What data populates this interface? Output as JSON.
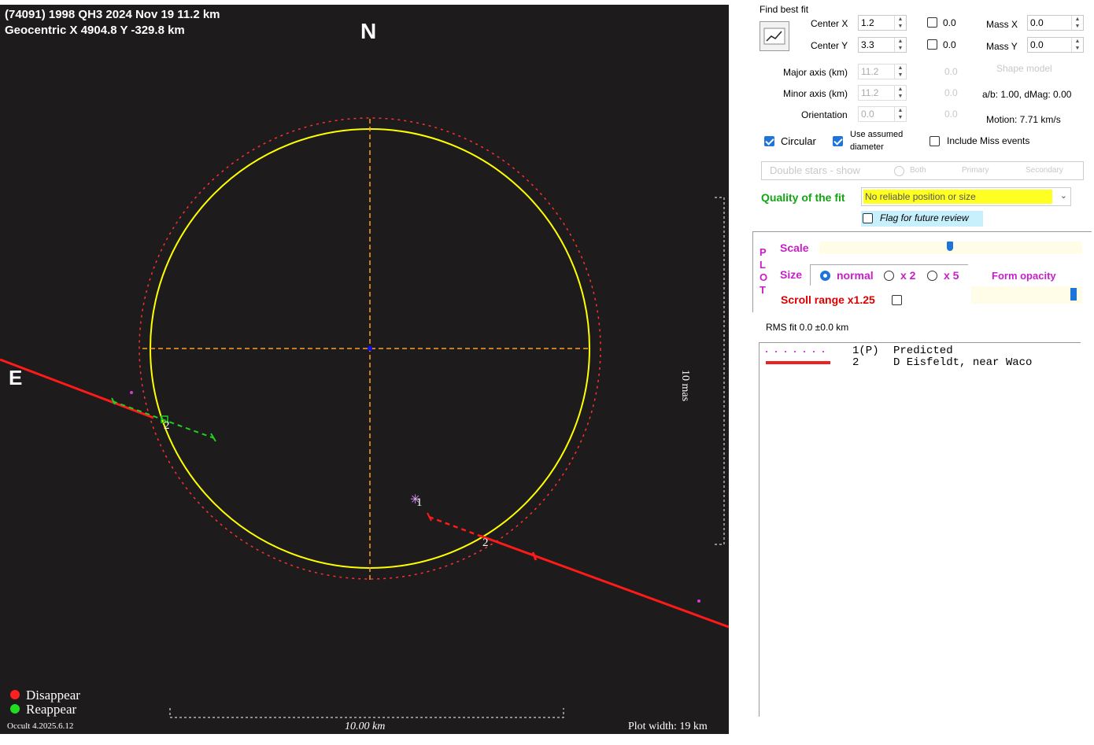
{
  "plot": {
    "title_line1": "(74091) 1998 QH3  2024 Nov 19   11.2 km",
    "title_line2": "Geocentric  X  4904.8  Y -329.8 km",
    "north": "N",
    "east": "E",
    "scale_vertical": "10 mas",
    "scale_horizontal": "10.00 km",
    "plot_width": "Plot width: 19 km",
    "version": "Occult 4.2025.6.12",
    "legend": [
      {
        "label": "Disappear",
        "color": "#ff2020"
      },
      {
        "label": "Reappear",
        "color": "#20dd20"
      }
    ],
    "chord_labels": {
      "predicted": "1",
      "observer": "2"
    },
    "colors": {
      "ellipse": "#ffff00",
      "dashed_ellipse": "#ff3030",
      "axes": "#ffa020",
      "chord": "#ff1a1a",
      "reappear": "#22cc22",
      "center": "#1010ff"
    }
  },
  "panel": {
    "find_best_fit": "Find best fit",
    "center_x_label": "Center X",
    "center_x_value": "1.2",
    "center_x_check": "0.0",
    "center_y_label": "Center Y",
    "center_y_value": "3.3",
    "center_y_check": "0.0",
    "mass_x_label": "Mass X",
    "mass_x_value": "0.0",
    "mass_y_label": "Mass Y",
    "mass_y_value": "0.0",
    "major_axis_label": "Major axis (km)",
    "major_axis_value": "11.2",
    "major_axis_check": "0.0",
    "minor_axis_label": "Minor axis (km)",
    "minor_axis_value": "11.2",
    "minor_axis_check": "0.0",
    "orientation_label": "Orientation",
    "orientation_value": "0.0",
    "orientation_check": "0.0",
    "shape_model": "Shape model",
    "ab_text": "a/b: 1.00, dMag: 0.00",
    "motion_text": "Motion: 7.71 km/s",
    "circular_label": "Circular",
    "use_assumed_line1": "Use assumed",
    "use_assumed_line2": "diameter",
    "include_miss": "Include Miss events",
    "double_stars": "Double stars - show",
    "ds_both": "Both",
    "ds_primary": "Primary",
    "ds_secondary": "Secondary",
    "quality_label": "Quality of the fit",
    "quality_value": "No reliable position or size",
    "flag_review": "Flag for future review",
    "plot_letters": [
      "P",
      "L",
      "O",
      "T"
    ],
    "scale_label": "Scale",
    "size_label": "Size",
    "size_normal": "normal",
    "size_x2": "x 2",
    "size_x5": "x 5",
    "form_opacity": "Form opacity",
    "scroll_range": "Scroll range x1.25",
    "rms_fit": "RMS fit 0.0 ±0.0 km",
    "chord_list": [
      {
        "id": "1(P)",
        "name": "Predicted"
      },
      {
        "id": "2",
        "name": "D Eisfeldt, near Waco"
      }
    ]
  }
}
